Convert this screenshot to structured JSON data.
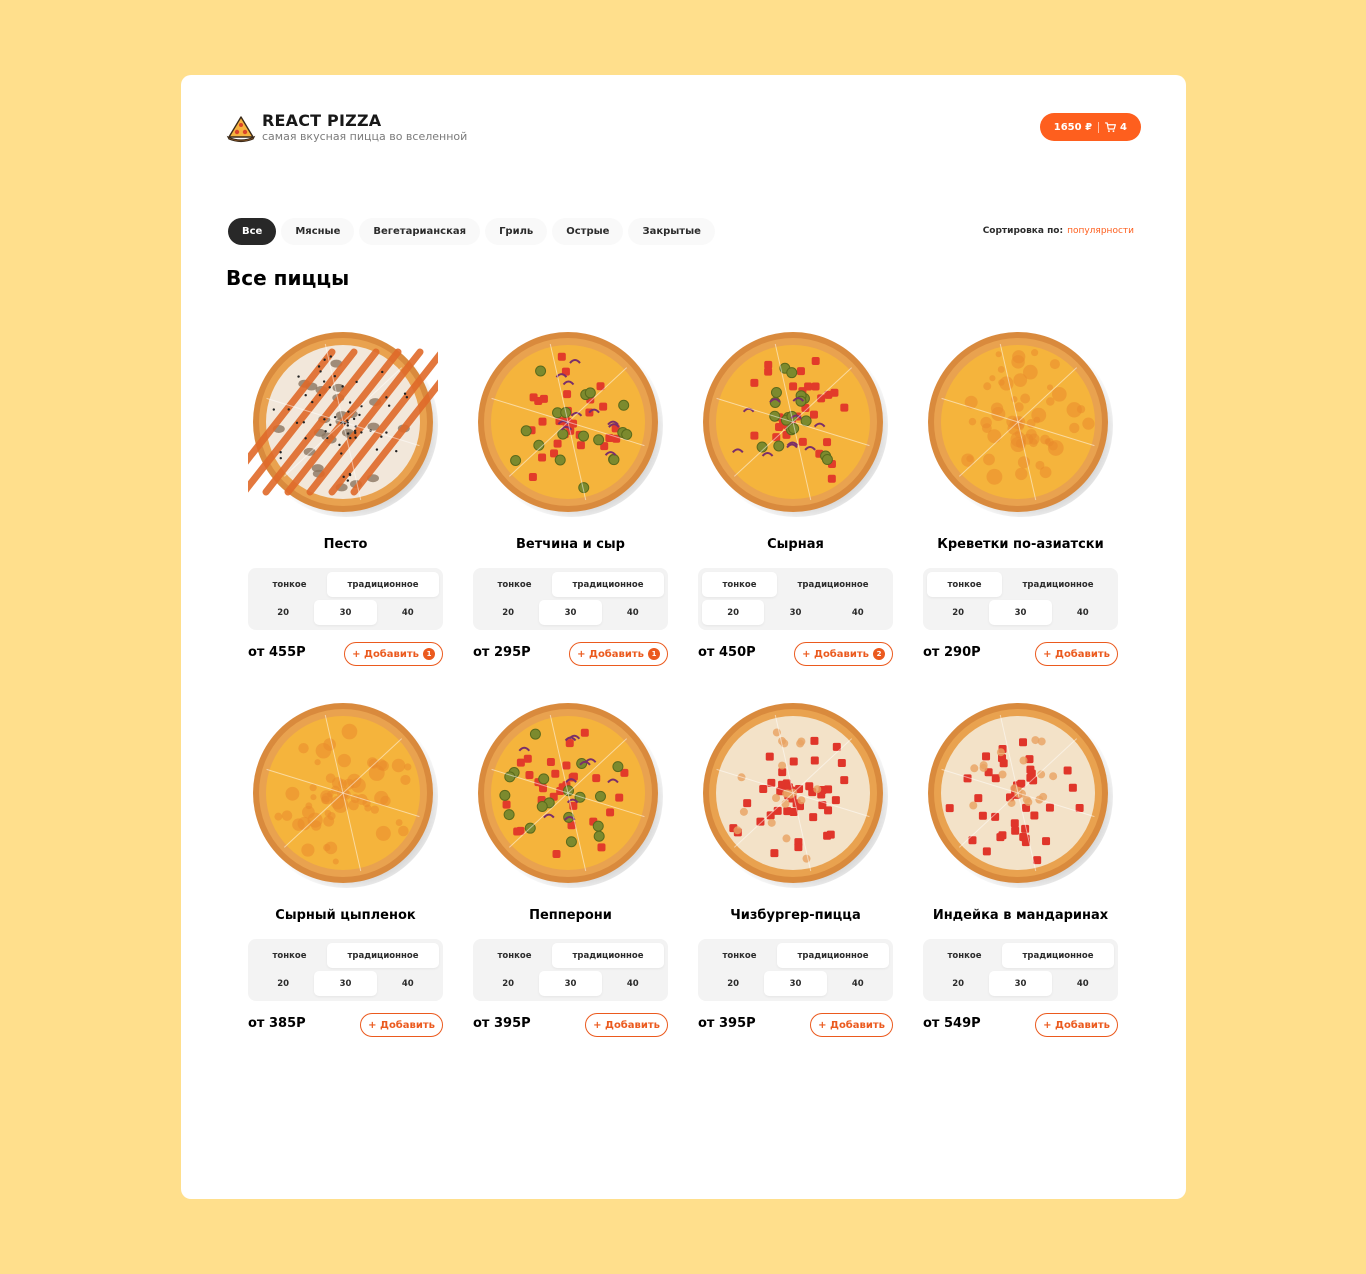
{
  "header": {
    "title": "REACT PIZZA",
    "subtitle": "самая вкусная пицца во вселенной",
    "cart_total": "1650 ₽",
    "cart_count": "4"
  },
  "categories": [
    "Все",
    "Мясные",
    "Вегетарианская",
    "Гриль",
    "Острые",
    "Закрытые"
  ],
  "active_category": "Все",
  "sort": {
    "label": "Сортировка по:",
    "value": "популярности"
  },
  "section_title": "Все пиццы",
  "colors": {
    "accent": "#FE5F1E",
    "background": "#FFDF8C",
    "active_category": "#282828"
  },
  "type_options": [
    "тонкое",
    "традиционное"
  ],
  "size_options": [
    "20",
    "30",
    "40"
  ],
  "add_label": "+ Добавить",
  "pizzas": [
    {
      "name": "Песто",
      "price": "от 455Р",
      "count": "1",
      "type": "традиционное",
      "size": "30",
      "topping": "pesto"
    },
    {
      "name": "Ветчина и сыр",
      "price": "от 295Р",
      "count": "1",
      "type": "традиционное",
      "size": "30",
      "topping": "veggie"
    },
    {
      "name": "Сырная",
      "price": "от 450Р",
      "count": "2",
      "type": "тонкое",
      "size": "20",
      "topping": "veggie"
    },
    {
      "name": "Креветки по-азиатски",
      "price": "от 290Р",
      "count": "",
      "type": "тонкое",
      "size": "30",
      "topping": "cheese"
    },
    {
      "name": "Сырный цыпленок",
      "price": "от 385Р",
      "count": "",
      "type": "традиционное",
      "size": "30",
      "topping": "cheese"
    },
    {
      "name": "Пепперони",
      "price": "от 395Р",
      "count": "",
      "type": "традиционное",
      "size": "30",
      "topping": "veggie"
    },
    {
      "name": "Чизбургер-пицца",
      "price": "от 395Р",
      "count": "",
      "type": "традиционное",
      "size": "30",
      "topping": "tomato"
    },
    {
      "name": "Индейка в мандаринах",
      "price": "от 549Р",
      "count": "",
      "type": "традиционное",
      "size": "30",
      "topping": "tomato"
    }
  ]
}
